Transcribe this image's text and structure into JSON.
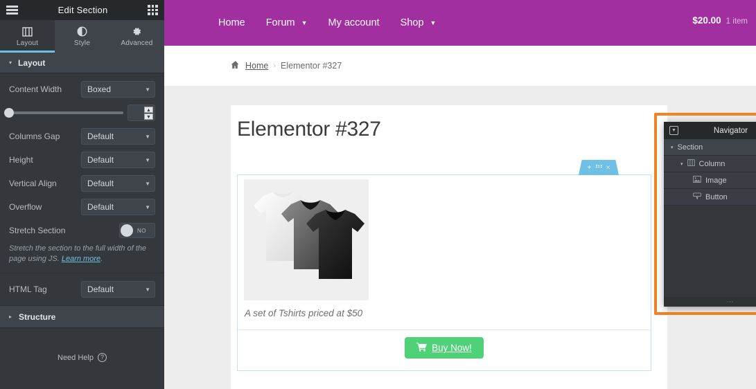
{
  "panel": {
    "header": {
      "title": "Edit Section",
      "menu_icon": "hamburger-icon",
      "apps_icon": "grid-apps-icon"
    },
    "tabs": [
      {
        "label": "Layout",
        "icon": "columns-icon",
        "active": true
      },
      {
        "label": "Style",
        "icon": "contrast-circle-icon",
        "active": false
      },
      {
        "label": "Advanced",
        "icon": "gear-icon",
        "active": false
      }
    ],
    "section_header": {
      "label": "Layout",
      "caret": "▾"
    },
    "controls": [
      {
        "label": "Content Width",
        "value": "Boxed",
        "type": "select"
      },
      {
        "label": "Columns Gap",
        "value": "Default",
        "type": "select"
      },
      {
        "label": "Height",
        "value": "Default",
        "type": "select"
      },
      {
        "label": "Vertical Align",
        "value": "Default",
        "type": "select"
      },
      {
        "label": "Overflow",
        "value": "Default",
        "type": "select"
      }
    ],
    "slider": {
      "value": "",
      "knob_percent": 0
    },
    "stretch": {
      "label": "Stretch Section",
      "state": "NO"
    },
    "hint": {
      "text": "Stretch the section to the full width of the page using JS. ",
      "link": "Learn more",
      "tail": "."
    },
    "html_tag": {
      "label": "HTML Tag",
      "value": "Default"
    },
    "structure": {
      "label": "Structure",
      "caret": "▸"
    },
    "need_help": {
      "label": "Need Help",
      "icon": "question-mark-icon"
    },
    "collapse": {
      "icon": "chevron-left-icon",
      "glyph": "‹"
    }
  },
  "site": {
    "nav": [
      {
        "label": "Home",
        "has_dropdown": false
      },
      {
        "label": "Forum",
        "has_dropdown": true
      },
      {
        "label": "My account",
        "has_dropdown": false
      },
      {
        "label": "Shop",
        "has_dropdown": true
      }
    ],
    "cart": {
      "amount": "$20.00",
      "count": "1 item"
    },
    "bar_color": "#a12fa0"
  },
  "breadcrumb": {
    "home_icon": "home-icon",
    "home": "Home",
    "separator": "›",
    "current": "Elementor #327"
  },
  "page": {
    "title": "Elementor #327",
    "section_handle": {
      "add": "+",
      "drag": "∷",
      "close": "×"
    },
    "image_alt": "three-tshirts-image",
    "caption": "A set of Tshirts priced at $50",
    "button": {
      "label": "Buy Now!",
      "icon": "shopping-cart-icon",
      "color": "#4fd178"
    }
  },
  "navigator": {
    "title": "Navigator",
    "dock_icon": "dock-toggle-icon",
    "close_icon": "close-icon",
    "items": [
      {
        "label": "Section",
        "level": 0,
        "caret": "▾",
        "icon": ""
      },
      {
        "label": "Column",
        "level": 1,
        "caret": "▾",
        "icon": "▥"
      },
      {
        "label": "Image",
        "level": 2,
        "caret": "",
        "icon": "ὛC"
      },
      {
        "label": "Button",
        "level": 2,
        "caret": "",
        "icon": "⎔"
      }
    ],
    "resize_handle": "⋯",
    "highlight_color": "#f58220"
  }
}
